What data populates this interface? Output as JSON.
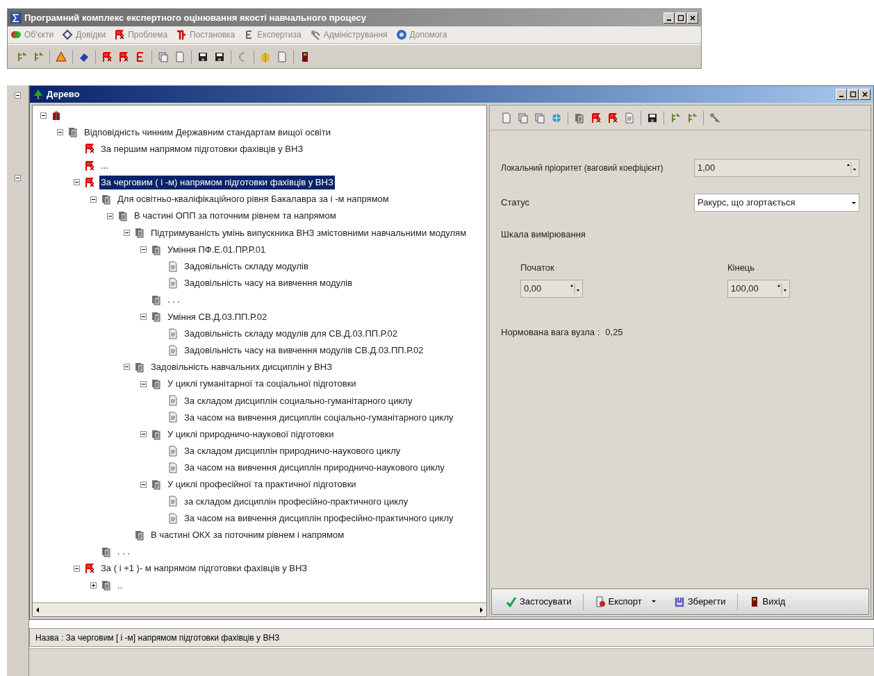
{
  "main_window": {
    "title": "Програмний комплекс експертного оцінювання якості навчального процесу",
    "menu": [
      {
        "label": "Об'єкти",
        "kind": "objects"
      },
      {
        "label": "Довідки",
        "kind": "references"
      },
      {
        "label": "Проблема",
        "kind": "problem"
      },
      {
        "label": "Постановка",
        "kind": "statement"
      },
      {
        "label": "Експертиза",
        "kind": "expertise"
      },
      {
        "label": "Адміністрування",
        "kind": "admin"
      },
      {
        "label": "Допомога",
        "kind": "help"
      }
    ]
  },
  "tree_window": {
    "title": "Дерево"
  },
  "tree": {
    "kind": "root",
    "expanded": true,
    "children": [
      {
        "kind": "folder",
        "label": "Відповідність чинним Державним стандартам вищої освіти",
        "expanded": true,
        "selected": false,
        "children": [
          {
            "kind": "problem",
            "label": "За першим напрямом підготовки  фахівців у ВНЗ",
            "selected": false
          },
          {
            "kind": "problem",
            "label": "...",
            "selected": false
          },
          {
            "kind": "problem",
            "label": "За черговим ( і -м) напрямом підготовки  фахівців у ВНЗ",
            "expanded": true,
            "selected": true,
            "children": [
              {
                "kind": "folder",
                "label": "Для освітньо-кваліфікаційного рівня Бакалавра  за і -м напрямом",
                "expanded": true,
                "selected": false,
                "children": [
                  {
                    "kind": "folder",
                    "label": "В частині ОПП за  поточним рівнем та напрямом",
                    "expanded": true,
                    "selected": false,
                    "children": [
                      {
                        "kind": "folder",
                        "label": "Підтримуваність умінь випускника ВНЗ змістовними навчальними модулям",
                        "expanded": true,
                        "selected": false,
                        "children": [
                          {
                            "kind": "folder",
                            "label": "Уміння ПФ.Е.01.ПР.Р.01",
                            "expanded": true,
                            "selected": false,
                            "children": [
                              {
                                "kind": "leaf",
                                "label": "Задовільність складу модулів",
                                "selected": false
                              },
                              {
                                "kind": "leaf",
                                "label": "Задовільність часу на вивчення модулів",
                                "selected": false
                              }
                            ]
                          },
                          {
                            "kind": "folder",
                            "label": ". . .",
                            "selected": false
                          },
                          {
                            "kind": "folder",
                            "label": "Уміння СВ.Д.03.ПП.Р.02",
                            "expanded": true,
                            "selected": false,
                            "children": [
                              {
                                "kind": "leaf",
                                "label": "Задовільність складу модулів для СВ.Д.03.ПП.Р.02",
                                "selected": false
                              },
                              {
                                "kind": "leaf",
                                "label": "Задовільність часу на вивчення модулів СВ.Д.03.ПП.Р.02",
                                "selected": false
                              }
                            ]
                          }
                        ]
                      },
                      {
                        "kind": "folder",
                        "label": "Задовільність навчальних дисциплін у ВНЗ",
                        "expanded": true,
                        "selected": false,
                        "children": [
                          {
                            "kind": "folder",
                            "label": "У циклі гуманітарної та соціальної підготовки",
                            "expanded": true,
                            "selected": false,
                            "children": [
                              {
                                "kind": "leaf",
                                "label": "За складом дисциплін социально-гуманітарного циклу",
                                "selected": false
                              },
                              {
                                "kind": "leaf",
                                "label": "За часом на вивчення  дисциплін соціально-гуманітарного циклу",
                                "selected": false
                              }
                            ]
                          },
                          {
                            "kind": "folder",
                            "label": "У циклі  природничо-наукової  підготовки",
                            "expanded": true,
                            "selected": false,
                            "children": [
                              {
                                "kind": "leaf",
                                "label": "За складом дисциплін природничо-наукового циклу",
                                "selected": false
                              },
                              {
                                "kind": "leaf",
                                "label": "За часом на вивчення дисциплін природничо-наукового циклу",
                                "selected": false
                              }
                            ]
                          },
                          {
                            "kind": "folder",
                            "label": "У циклі професійної та практичної підготовки",
                            "expanded": true,
                            "selected": false,
                            "children": [
                              {
                                "kind": "leaf",
                                "label": "за складом дисциплін професійно-практичного циклу",
                                "selected": false
                              },
                              {
                                "kind": "leaf",
                                "label": "За часом на вивчення дисциплін професійно-практичного циклу",
                                "selected": false
                              }
                            ]
                          }
                        ]
                      },
                      {
                        "kind": "folder",
                        "label": "В частині ОКХ за  поточним рівнем і напрямом",
                        "selected": false
                      }
                    ]
                  }
                ]
              },
              {
                "kind": "folder",
                "label": ". . .",
                "selected": false
              }
            ]
          },
          {
            "kind": "problem",
            "label": "За ( і +1 )- м напрямом підготовки  фахівців у ВНЗ",
            "expanded": true,
            "selected": false,
            "children": [
              {
                "kind": "folder",
                "label": "..",
                "expanded": false,
                "selected": false
              }
            ]
          }
        ]
      }
    ]
  },
  "properties": {
    "priority": {
      "label": "Локальний пріоритет (ваговий коефіцієнт)",
      "value": "1,00"
    },
    "status": {
      "label": "Статус",
      "value": "Ракурс, що згортається"
    },
    "scale": {
      "label": "Шкала вимірювання",
      "start": {
        "label": "Початок",
        "value": "0,00"
      },
      "end": {
        "label": "Кінець",
        "value": "100,00"
      }
    },
    "weight": {
      "label": "Нормована вага вузла :",
      "value": "0,25"
    }
  },
  "buttons": [
    {
      "label": "Застосувати",
      "kind": "apply"
    },
    {
      "label": "Експорт",
      "kind": "export"
    },
    {
      "label": "Зберегти",
      "kind": "save"
    },
    {
      "label": "Вихід",
      "kind": "exit"
    }
  ],
  "status_bar": {
    "text": "Назва : За черговим [ і -м] напрямом підготовки  фахівців у ВНЗ"
  }
}
